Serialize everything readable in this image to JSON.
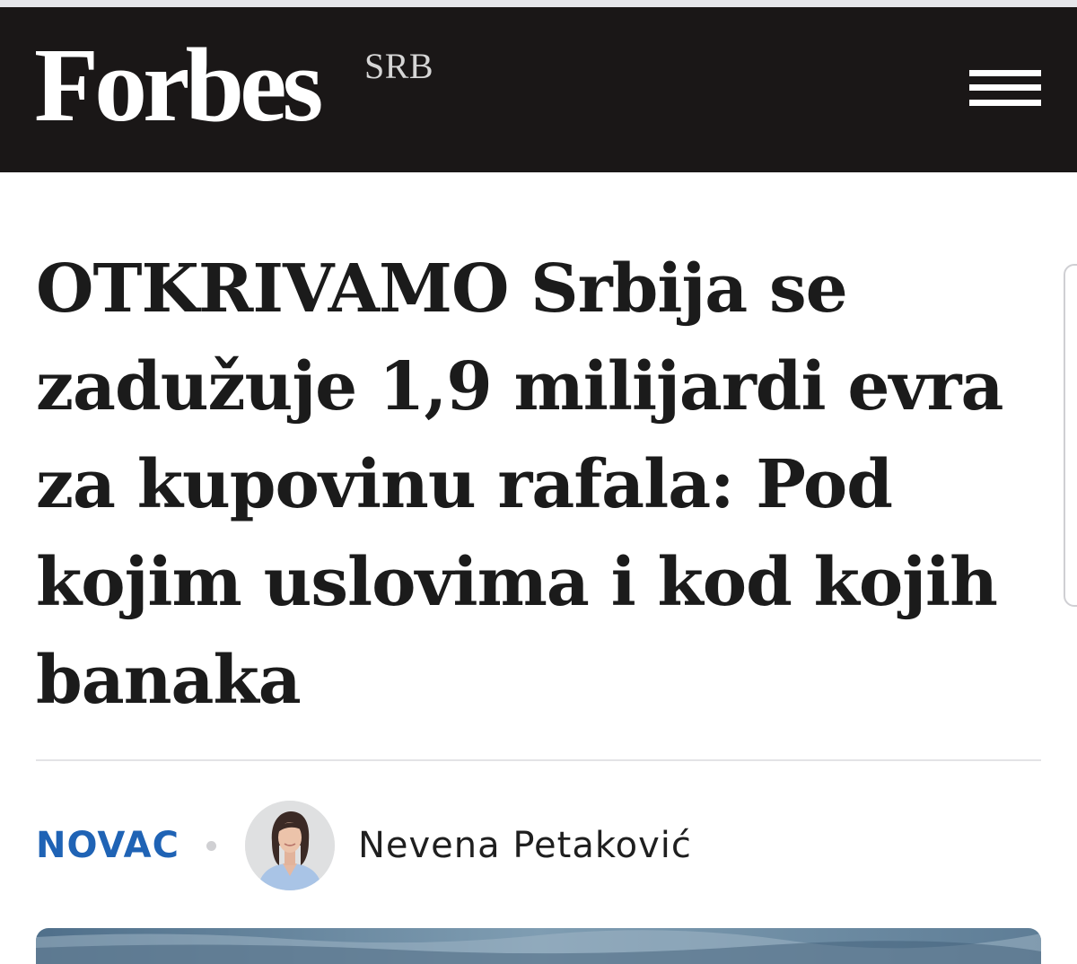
{
  "header": {
    "logo_text": "Forbes",
    "edition_label": "SRB",
    "menu_icon": "hamburger-menu-icon",
    "background_color": "#1a1717"
  },
  "article": {
    "headline": "OTKRIVAMO Srbija se zadužuje 1,9 milijardi evra za kupovinu rafala: Pod kojim uslovima i kod kojih banaka",
    "category": "NOVAC",
    "category_color": "#1f63b5",
    "author_name": "Nevena Petaković"
  }
}
